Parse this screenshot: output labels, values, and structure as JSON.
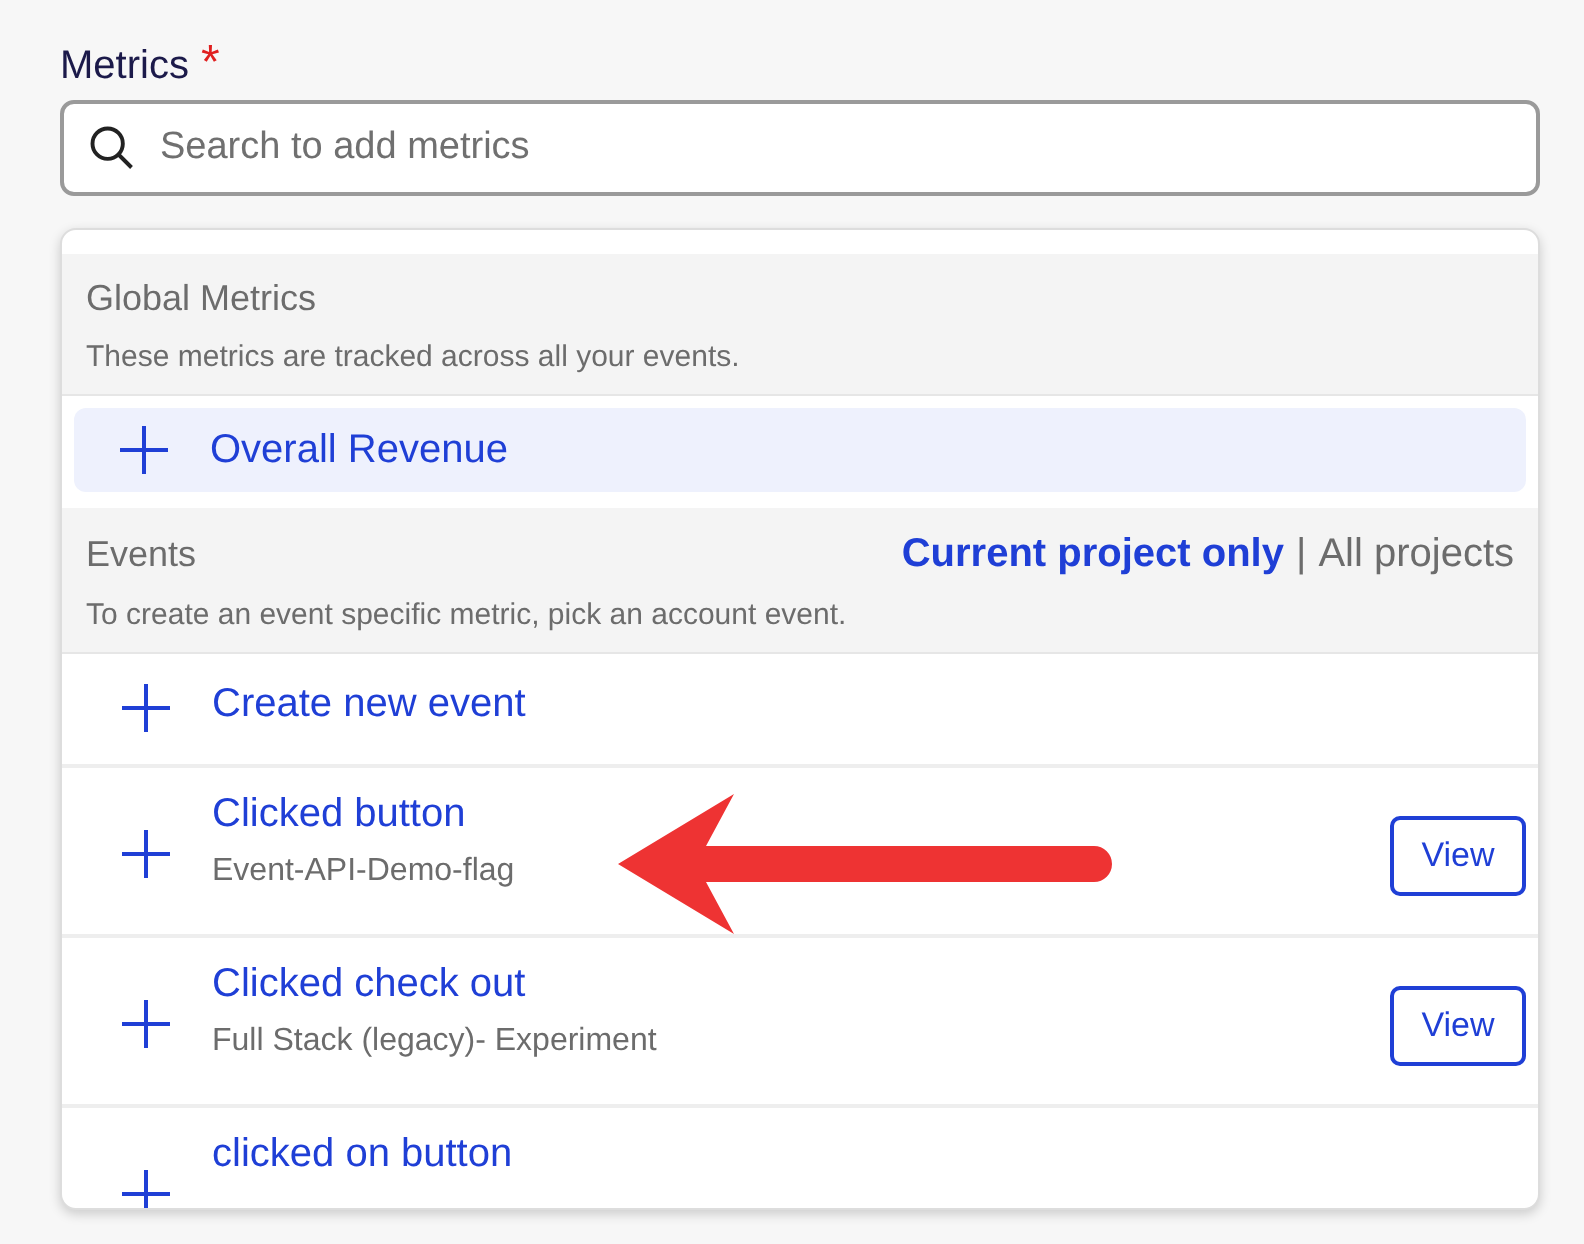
{
  "field": {
    "label": "Metrics",
    "required_mark": "*",
    "placeholder": "Search to add metrics"
  },
  "global_section": {
    "title": "Global Metrics",
    "description": "These metrics are tracked across all your events."
  },
  "global_items": [
    {
      "label": "Overall Revenue",
      "selected": true
    }
  ],
  "events_section": {
    "title": "Events",
    "description": "To create an event specific metric, pick an account event.",
    "separator": "|",
    "filters": [
      {
        "label": "Current project only",
        "selected": true
      },
      {
        "label": "All projects",
        "selected": false
      }
    ]
  },
  "events": [
    {
      "kind": "create",
      "title": "Create new event"
    },
    {
      "kind": "event",
      "title": "Clicked button",
      "subtitle": "Event-API-Demo-flag",
      "button": "View",
      "annotated": true
    },
    {
      "kind": "event",
      "title": "Clicked check out",
      "subtitle": "Full Stack (legacy)- Experiment",
      "button": "View",
      "annotated": false
    },
    {
      "kind": "event",
      "title": "clicked on button",
      "annotated": false
    }
  ]
}
